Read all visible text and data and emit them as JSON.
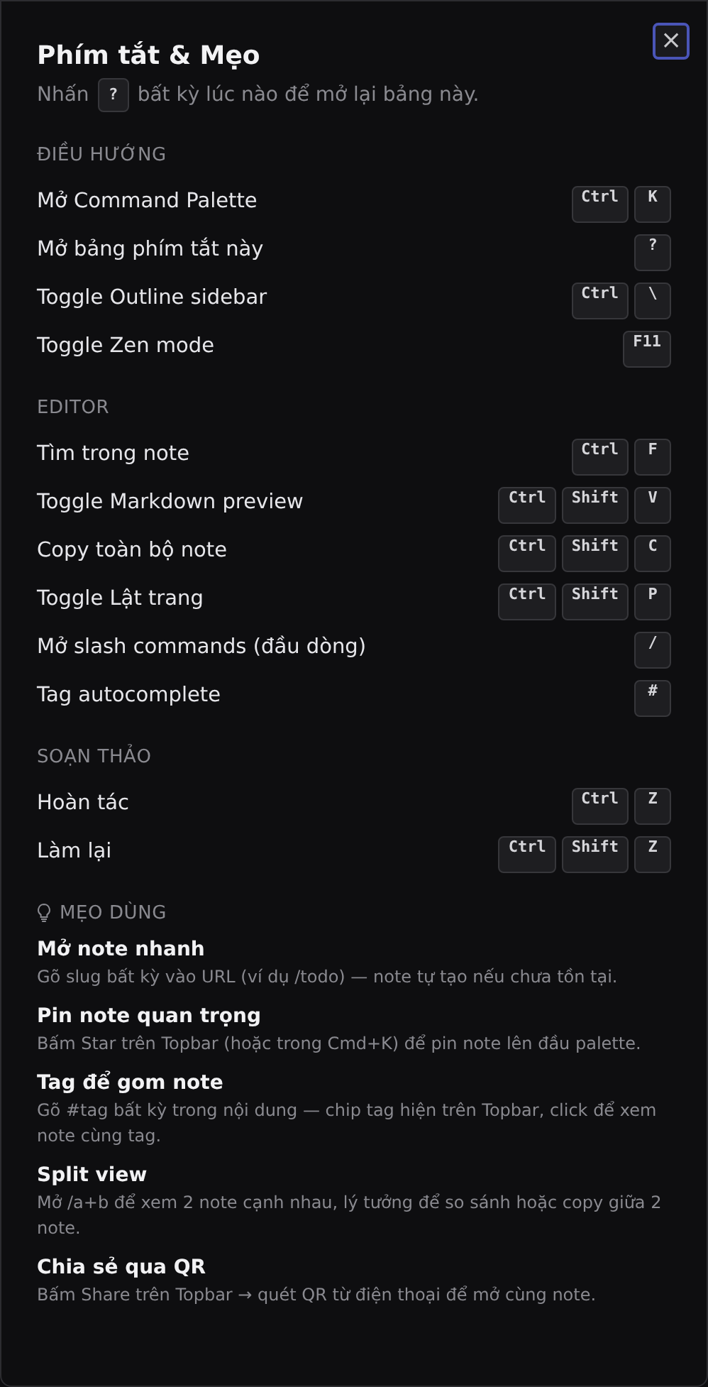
{
  "dialog": {
    "title": "Phím tắt & Mẹo",
    "subtitle": {
      "before": "Nhấn",
      "key": "?",
      "after": "bất kỳ lúc nào để mở lại bảng này."
    },
    "close_button": {
      "label": "×"
    }
  },
  "sections": [
    {
      "title": "ĐIỀU HƯỚNG",
      "kind": "shortcuts",
      "items": [
        {
          "label": "Mở Command Palette",
          "keys": [
            "Ctrl",
            "K"
          ]
        },
        {
          "label": "Mở bảng phím tắt này",
          "keys": [
            "?"
          ]
        },
        {
          "label": "Toggle Outline sidebar",
          "keys": [
            "Ctrl",
            "\\"
          ]
        },
        {
          "label": "Toggle Zen mode",
          "keys": [
            "F11"
          ]
        }
      ]
    },
    {
      "title": "EDITOR",
      "kind": "shortcuts",
      "items": [
        {
          "label": "Tìm trong note",
          "keys": [
            "Ctrl",
            "F"
          ]
        },
        {
          "label": "Toggle Markdown preview",
          "keys": [
            "Ctrl",
            "Shift",
            "V"
          ]
        },
        {
          "label": "Copy toàn bộ note",
          "keys": [
            "Ctrl",
            "Shift",
            "C"
          ]
        },
        {
          "label": "Toggle Lật trang",
          "keys": [
            "Ctrl",
            "Shift",
            "P"
          ]
        },
        {
          "label": "Mở slash commands (đầu dòng)",
          "keys": [
            "/"
          ]
        },
        {
          "label": "Tag autocomplete",
          "keys": [
            "#"
          ]
        }
      ]
    },
    {
      "title": "SOẠN THẢO",
      "kind": "shortcuts",
      "items": [
        {
          "label": "Hoàn tác",
          "keys": [
            "Ctrl",
            "Z"
          ]
        },
        {
          "label": "Làm lại",
          "keys": [
            "Ctrl",
            "Shift",
            "Z"
          ]
        }
      ]
    },
    {
      "title": "MẸO DÙNG",
      "kind": "tips",
      "items": [
        {
          "title": "Mở note nhanh",
          "text": "Gõ slug bất kỳ vào URL (ví dụ /todo) — note tự tạo nếu chưa tồn tại."
        },
        {
          "title": "Pin note quan trọng",
          "text": "Bấm Star trên Topbar (hoặc trong Cmd+K) để pin note lên đầu palette."
        },
        {
          "title": "Tag để gom note",
          "text": "Gõ #tag bất kỳ trong nội dung — chip tag hiện trên Topbar, click để xem note cùng tag."
        },
        {
          "title": "Split view",
          "text": "Mở /a+b để xem 2 note cạnh nhau, lý tưởng để so sánh hoặc copy giữa 2 note."
        },
        {
          "title": "Chia sẻ qua QR",
          "text": "Bấm Share trên Topbar → quét QR từ điện thoại để mở cùng note."
        }
      ]
    }
  ]
}
